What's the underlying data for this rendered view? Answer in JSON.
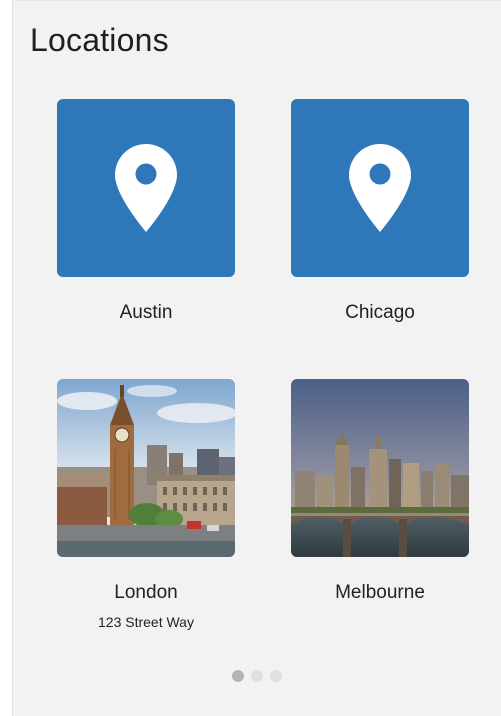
{
  "page": {
    "title": "Locations"
  },
  "locations": [
    {
      "name": "Austin",
      "address": "",
      "image": "map-pin-icon"
    },
    {
      "name": "Chicago",
      "address": "",
      "image": "map-pin-icon"
    },
    {
      "name": "London",
      "address": "123 Street Way",
      "image": "london-photo"
    },
    {
      "name": "Melbourne",
      "address": "",
      "image": "melbourne-photo"
    }
  ],
  "pagination": {
    "pages": 3,
    "active": 1
  },
  "colors": {
    "tile_blue": "#2e78b9",
    "panel_bg": "#f2f2f2",
    "dot_active": "#b5b5b5",
    "dot_inactive": "#e0e0e0"
  }
}
